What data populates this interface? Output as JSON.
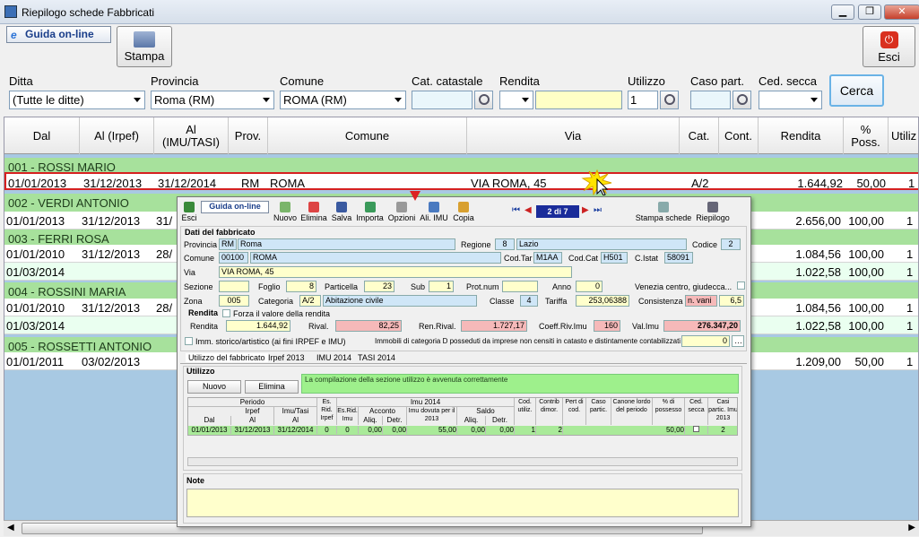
{
  "window": {
    "title": "Riepilogo schede Fabbricati",
    "minimize": "▁",
    "maximize": "❐",
    "close": "✕"
  },
  "toolbar": {
    "guida": "Guida on-line",
    "stampa": "Stampa",
    "esci": "Esci"
  },
  "filters": {
    "ditta": {
      "label": "Ditta",
      "value": "(Tutte le ditte)"
    },
    "provincia": {
      "label": "Provincia",
      "value": "Roma (RM)"
    },
    "comune": {
      "label": "Comune",
      "value": "ROMA (RM)"
    },
    "cat_catastale": {
      "label": "Cat. catastale",
      "value": ""
    },
    "rendita": {
      "label": "Rendita",
      "value": ""
    },
    "utilizzo": {
      "label": "Utilizzo",
      "value": "1"
    },
    "caso_part": {
      "label": "Caso part.",
      "value": ""
    },
    "ced_secca": {
      "label": "Ced. secca",
      "value": ""
    },
    "cerca": "Cerca"
  },
  "grid": {
    "headers": [
      "Dal",
      "Al (Irpef)",
      "Al\n(IMU/TASI)",
      "Prov.",
      "Comune",
      "Via",
      "Cat.",
      "Cont.",
      "Rendita",
      "%\nPoss.",
      "Utiliz"
    ],
    "groups": [
      {
        "name": "001 - ROSSI MARIO",
        "rows": [
          [
            "01/01/2013",
            "31/12/2013",
            "31/12/2014",
            "RM",
            "ROMA",
            "VIA ROMA, 45",
            "A/2",
            "",
            "1.644,92",
            "50,00",
            "1"
          ]
        ]
      },
      {
        "name": "002 - VERDI ANTONIO",
        "rows": [
          [
            "01/01/2013",
            "31/12/2013",
            "31/",
            "",
            "",
            "",
            "",
            "",
            "2.656,00",
            "100,00",
            "1"
          ]
        ]
      },
      {
        "name": "003 - FERRI ROSA",
        "rows": [
          [
            "01/01/2010",
            "31/12/2013",
            "28/",
            "",
            "",
            "",
            "",
            "",
            "1.084,56",
            "100,00",
            "1"
          ],
          [
            "01/03/2014",
            "",
            "",
            "",
            "",
            "",
            "",
            "",
            "1.022,58",
            "100,00",
            "1"
          ]
        ]
      },
      {
        "name": "004 - ROSSINI MARIA",
        "rows": [
          [
            "01/01/2010",
            "31/12/2013",
            "28/",
            "",
            "",
            "",
            "",
            "",
            "1.084,56",
            "100,00",
            "1"
          ],
          [
            "01/03/2014",
            "",
            "",
            "",
            "",
            "",
            "",
            "",
            "1.022,58",
            "100,00",
            "1"
          ]
        ]
      },
      {
        "name": "005 - ROSSETTI ANTONIO",
        "rows": [
          [
            "01/01/2011",
            "03/02/2013",
            "",
            "",
            "",
            "",
            "",
            "",
            "1.209,00",
            "50,00",
            "1"
          ]
        ]
      }
    ]
  },
  "popup": {
    "toolbar": [
      "Esci",
      "Guida on-line",
      "Nuovo",
      "Elimina",
      "Salva",
      "Importa",
      "Opzioni",
      "Ali. IMU",
      "Copia",
      "Stampa schede",
      "Riepilogo"
    ],
    "pager": "2 di 7",
    "section_dati": "Dati del fabbricato",
    "provincia_label": "Provincia",
    "provincia_code": "RM",
    "provincia_name": "Roma",
    "regione_label": "Regione",
    "regione_code": "8",
    "regione_name": "Lazio",
    "codice_label": "Codice",
    "codice": "2",
    "comune_label": "Comune",
    "cap": "00100",
    "comune_name": "ROMA",
    "codtar_label": "Cod.Tar",
    "codtar": "M1AA",
    "codcat_label": "Cod.Cat",
    "codcat": "H501",
    "cistat_label": "C.Istat",
    "cistat": "58091",
    "via_label": "Via",
    "via": "VIA ROMA, 45",
    "sezione_label": "Sezione",
    "sezione": "",
    "foglio_label": "Foglio",
    "foglio": "8",
    "particella_label": "Particella",
    "particella": "23",
    "sub_label": "Sub",
    "sub": "1",
    "protnum_label": "Prot.num",
    "protnum": "",
    "anno_label": "Anno",
    "anno": "0",
    "venezia_label": "Venezia centro, giudecca...",
    "zona_label": "Zona",
    "zona": "005",
    "categoria_label": "Categoria",
    "categoria": "A/2",
    "categoria_desc": "Abitazione civile",
    "classe_label": "Classe",
    "classe": "4",
    "tariffa_label": "Tariffa",
    "tariffa": "253,06388",
    "consistenza_label": "Consistenza",
    "consistenza_unit": "n. vani",
    "consistenza": "6,5",
    "rendita_section": "Rendita",
    "forza_label": "Forza il valore della rendita",
    "rendita_label": "Rendita",
    "rendita": "1.644,92",
    "rival_label": "Rival.",
    "rival": "82,25",
    "renrival_label": "Ren.Rival.",
    "renrival": "1.727,17",
    "coeff_label": "Coeff.Riv.Imu",
    "coeff": "160",
    "valimu_label": "Val.Imu",
    "valimu": "276.347,20",
    "imm_storico": "Imm. storico/artistico (ai fini IRPEF e IMU)",
    "immobili_cat": "Immobili di categoria D posseduti da imprese non censiti in catasto e distintamente contabilizzati",
    "immobili_val": "0",
    "tabs": [
      "Utilizzo del fabbricato",
      "Irpef 2013",
      "IMU 2014",
      "TASI 2014"
    ],
    "utilizzo_section": "Utilizzo",
    "nuovo": "Nuovo",
    "elimina": "Elimina",
    "message": "La compilazione della sezione utilizzo è avvenuta correttamente",
    "table_head": {
      "periodo": "Periodo",
      "irpef": "Irpef",
      "imutasi": "Imu/Tasi",
      "dal": "Dal",
      "al": "Al",
      "al2": "Al",
      "esrid_irpef": "Es. Rid. Irpef",
      "esrid_imu": "Es.Rid. Imu",
      "imu2014": "Imu 2014",
      "acconto": "Acconto",
      "aliq": "Aliq.",
      "detr": "Detr.",
      "imu_dovuta": "Imu dovuta per il 2013",
      "saldo": "Saldo",
      "aliq2": "Aliq.",
      "detr2": "Detr.",
      "cod_utiliz": "Cod. utiliz.",
      "contrib": "Contrib dimor.",
      "pert": "Pert di cod.",
      "caso": "Caso partic.",
      "canone": "Canone lordo del periodo",
      "perc": "% di possesso",
      "ced": "Ced. secca",
      "casi": "Casi partic. Imu 2013"
    },
    "table_row": [
      "01/01/2013",
      "31/12/2013",
      "31/12/2014",
      "0",
      "0",
      "0,00",
      "0,00",
      "55,00",
      "0,00",
      "0,00",
      "1",
      "2",
      "",
      "",
      "",
      "50,00",
      "",
      "2"
    ],
    "note_label": "Note"
  }
}
